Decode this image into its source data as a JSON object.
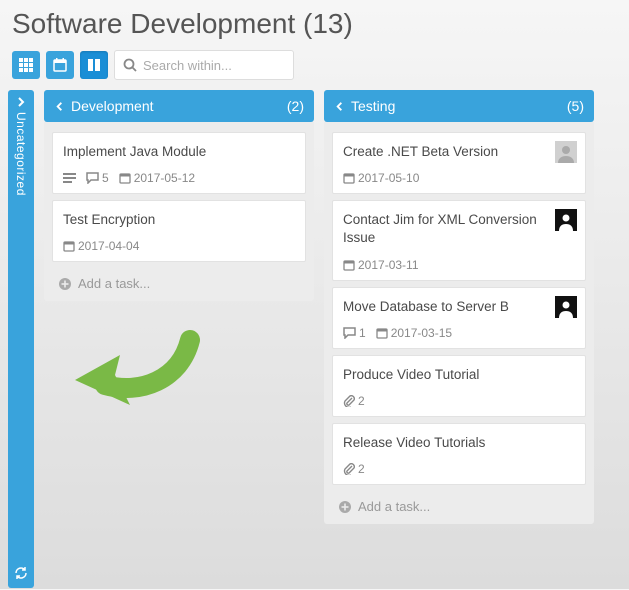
{
  "title": "Software Development (13)",
  "search": {
    "placeholder": "Search within..."
  },
  "rail": {
    "label": "Uncategorized"
  },
  "addTaskLabel": "Add a task...",
  "columns": [
    {
      "name": "Development",
      "count": "(2)",
      "cards": [
        {
          "title": "Implement Java Module",
          "desc": true,
          "comments": "5",
          "date": "2017-05-12",
          "avatar": "",
          "attach": ""
        },
        {
          "title": "Test Encryption",
          "desc": false,
          "comments": "",
          "date": "2017-04-04",
          "avatar": "",
          "attach": ""
        }
      ]
    },
    {
      "name": "Testing",
      "count": "(5)",
      "cards": [
        {
          "title": "Create .NET Beta Version",
          "desc": false,
          "comments": "",
          "date": "2017-05-10",
          "avatar": "generic",
          "attach": ""
        },
        {
          "title": "Contact Jim for XML Conversion Issue",
          "desc": false,
          "comments": "",
          "date": "2017-03-11",
          "avatar": "dark",
          "attach": ""
        },
        {
          "title": "Move Database to Server B",
          "desc": false,
          "comments": "1",
          "date": "2017-03-15",
          "avatar": "dark",
          "attach": ""
        },
        {
          "title": "Produce Video Tutorial",
          "desc": false,
          "comments": "",
          "date": "",
          "avatar": "",
          "attach": "2"
        },
        {
          "title": "Release Video Tutorials",
          "desc": false,
          "comments": "",
          "date": "",
          "avatar": "",
          "attach": "2"
        }
      ]
    }
  ]
}
